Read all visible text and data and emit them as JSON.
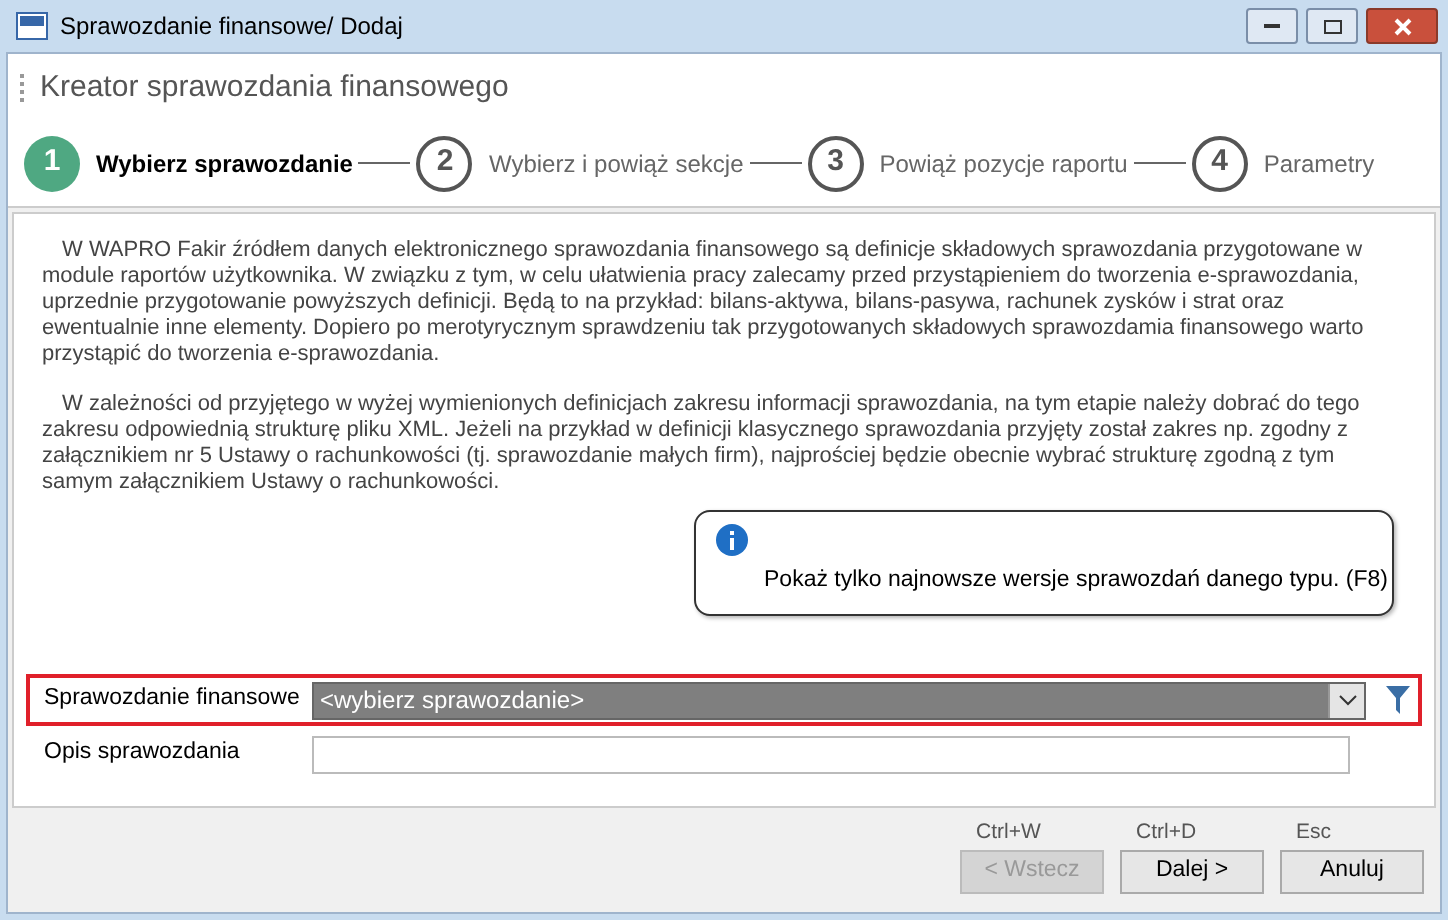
{
  "window": {
    "title": "Sprawozdanie finansowe/ Dodaj"
  },
  "wizard": {
    "title": "Kreator sprawozdania finansowego",
    "steps": [
      {
        "number": "1",
        "label": "Wybierz sprawozdanie",
        "selected": true
      },
      {
        "number": "2",
        "label": "Wybierz i powiąż sekcje",
        "selected": false
      },
      {
        "number": "3",
        "label": "Powiąż pozycje raportu",
        "selected": false
      },
      {
        "number": "4",
        "label": "Parametry",
        "selected": false
      }
    ]
  },
  "paragraphs": [
    "W WAPRO Fakir źródłem danych elektronicznego sprawozdania finansowego są definicje składowych sprawozdania przygotowane w module raportów użytkownika. W związku z tym, w celu ułatwienia pracy zalecamy przed przystąpieniem do tworzenia e-sprawozdania, uprzednie przygotowanie powyższych definicji. Będą to na przykład: bilans-aktywa, bilans-pasywa, rachunek zysków i strat oraz ewentualnie inne elementy. Dopiero po merotyrycznym sprawdzeniu tak przygotowanych składowych sprawozdamia finansowego warto przystąpić do tworzenia e-sprawozdania.",
    "W zależności od przyjętego w wyżej wymienionych definicjach zakresu informacji sprawozdania, na tym etapie należy dobrać do tego zakresu odpowiednią strukturę pliku XML. Jeżeli na przykład w definicji klasycznego sprawozdania przyjęty został zakres np. zgodny z załącznikiem nr 5 Ustawy o rachunkowości (tj. sprawozdanie małych firm), najprościej będzie obecnie wybrać strukturę zgodną z tym samym załącznikiem Ustawy o rachunkowości."
  ],
  "tooltip": {
    "text": "Pokaż tylko najnowsze wersje sprawozdań danego typu. (F8)"
  },
  "form": [
    {
      "kind": "select",
      "label": "Sprawozdanie finansowe",
      "value": "<wybierz sprawozdanie>"
    },
    {
      "kind": "text",
      "label": "Opis sprawozdania"
    }
  ],
  "buttons": [
    {
      "shortcut": "Ctrl+W",
      "label": "< Wstecz",
      "disabled": true
    },
    {
      "shortcut": "Ctrl+D",
      "label": "Dalej >",
      "disabled": false
    },
    {
      "shortcut": "Esc",
      "label": "Anuluj",
      "disabled": false
    }
  ]
}
